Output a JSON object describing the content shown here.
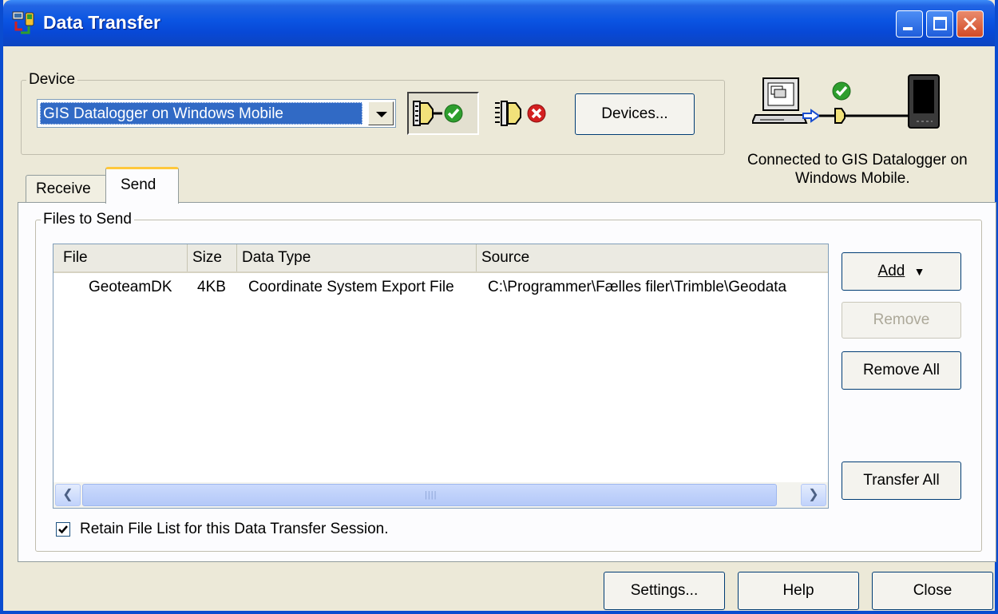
{
  "window": {
    "title": "Data Transfer"
  },
  "device": {
    "group_label": "Device",
    "selected": "GIS Datalogger on Windows Mobile",
    "connect_icon": "connect-plug-check-icon",
    "disconnect_icon": "disconnect-plug-x-icon",
    "devices_button": "Devices..."
  },
  "status": {
    "icon": "pc-to-handheld-connected-icon",
    "line1": "Connected to GIS Datalogger on",
    "line2": "Windows Mobile."
  },
  "tabs": [
    {
      "label": "Receive",
      "active": false
    },
    {
      "label": "Send",
      "active": true
    }
  ],
  "files": {
    "group_label": "Files to Send",
    "columns": [
      "File",
      "Size",
      "Data Type",
      "Source"
    ],
    "rows": [
      {
        "file": "GeoteamDK",
        "size": "4KB",
        "type": "Coordinate System Export File",
        "source": "C:\\Programmer\\Fælles filer\\Trimble\\Geodata"
      }
    ],
    "retain_label": "Retain File List for this Data Transfer Session.",
    "retain_checked": true
  },
  "side_buttons": {
    "add": "Add",
    "remove": "Remove",
    "remove_all": "Remove All",
    "transfer_all": "Transfer All"
  },
  "bottom_buttons": {
    "settings": "Settings...",
    "help": "Help",
    "close": "Close"
  },
  "colors": {
    "titlebar": "#0A54E2",
    "selection": "#316AC5",
    "ok_green": "#2E9E2E",
    "error_red": "#D42020"
  }
}
